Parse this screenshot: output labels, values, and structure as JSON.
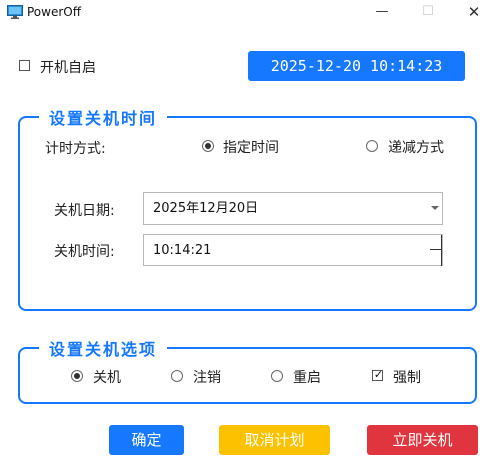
{
  "window": {
    "title": "PowerOff",
    "min_glyph": "—",
    "max_glyph": "☐",
    "close_glyph": "✕"
  },
  "autostart": {
    "label": "开机自启",
    "checked": false
  },
  "clock": {
    "text": "2025-12-20 10:14:23"
  },
  "shutdown_time_group": {
    "title": "设置关机时间",
    "timing_mode_label": "计时方式:",
    "modes": [
      {
        "label": "指定时间",
        "checked": true
      },
      {
        "label": "递减方式",
        "checked": false
      }
    ],
    "date_label": "关机日期:",
    "date_value": "2025年12月20日",
    "time_label": "关机时间:",
    "time_value": "10:14:21"
  },
  "options_group": {
    "title": "设置关机选项",
    "actions": [
      {
        "label": "关机",
        "checked": true
      },
      {
        "label": "注销",
        "checked": false
      },
      {
        "label": "重启",
        "checked": false
      }
    ],
    "force": {
      "label": "强制",
      "checked": true,
      "glyph": "✓"
    }
  },
  "buttons": {
    "confirm": "确定",
    "cancel_plan": "取消计划",
    "shutdown_now": "立即关机"
  },
  "colors": {
    "accent": "#1677ff",
    "cancel": "#fdc100",
    "danger": "#e0353e"
  }
}
